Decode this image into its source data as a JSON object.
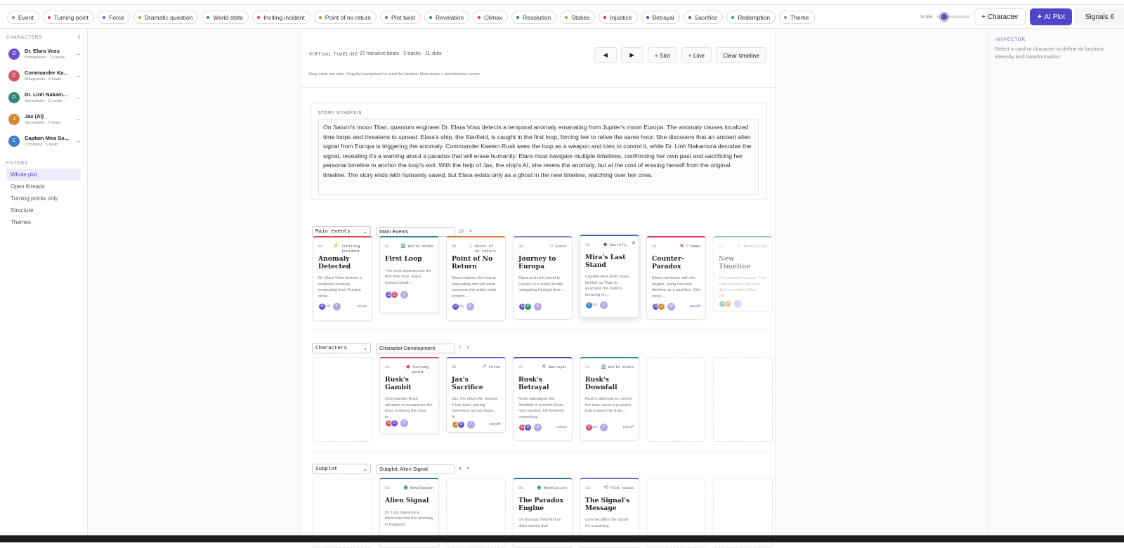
{
  "tags": [
    {
      "label": "Event",
      "color": "#8d85d6"
    },
    {
      "label": "Turning point",
      "color": "#d9475f"
    },
    {
      "label": "Force",
      "color": "#6c5ccf"
    },
    {
      "label": "Dramatic question",
      "color": "#d9863a"
    },
    {
      "label": "World state",
      "color": "#2f8a88"
    },
    {
      "label": "Inciting incident",
      "color": "#d9475f"
    },
    {
      "label": "Point of no return",
      "color": "#e07a2a"
    },
    {
      "label": "Plot twist",
      "color": "#7a5fd6"
    },
    {
      "label": "Revelation",
      "color": "#2f7da0"
    },
    {
      "label": "Climax",
      "color": "#d9385a"
    },
    {
      "label": "Resolution",
      "color": "#2f8a70"
    },
    {
      "label": "Stakes",
      "color": "#d9863a"
    },
    {
      "label": "Injustice",
      "color": "#c83a50"
    },
    {
      "label": "Betrayal",
      "color": "#4a4aa8"
    },
    {
      "label": "Sacrifice",
      "color": "#3d6aa8"
    },
    {
      "label": "Redemption",
      "color": "#2f9a8a"
    },
    {
      "label": "Theme",
      "color": "#8d85d6"
    }
  ],
  "toolbar": {
    "scale_label": "Scale",
    "character_button": "+ Character",
    "ai_button": "✦ AI Plot",
    "signals_button": "Signals 6"
  },
  "sidebar": {
    "characters_heading": "CHARACTERS",
    "characters_count": "5",
    "characters": [
      {
        "initial": "D",
        "name": "Dr. Elara Voss",
        "sub": "Protagonista · 15 beats",
        "color": "#6b4fcf"
      },
      {
        "initial": "C",
        "name": "Commander Ka...",
        "sub": "Antagonista · 4 beats",
        "color": "#d2566a"
      },
      {
        "initial": "D",
        "name": "Dr. Linh Nakam...",
        "sub": "Secondario · 11 beats",
        "color": "#2f8a7a"
      },
      {
        "initial": "J",
        "name": "Jax (AI)",
        "sub": "Secondario · 7 beats",
        "color": "#d48a30"
      },
      {
        "initial": "C",
        "name": "Captain Mira So...",
        "sub": "Comparsa · 1 beats",
        "color": "#3d7fc8"
      }
    ],
    "filters_heading": "FILTERS",
    "filters": [
      "Whole plot",
      "Open threads",
      "Turning points only",
      "Structure",
      "Themes"
    ]
  },
  "inspector": {
    "heading": "INSPECTOR",
    "text": "Select a card or character to define its function, intensity and transformation."
  },
  "timeline": {
    "heading": "VIRTUAL TIMELINE",
    "info": "27 narrative beats · 5 tracks · 11 slots",
    "buttons": {
      "prev": "◀",
      "next": "▶",
      "slot": "+ Slot",
      "line": "+ Line",
      "clear": "Clear timeline"
    },
    "hint": "Drag cards into slots. Drag the background to scroll the timeline. More tracks = simultaneous events."
  },
  "synopsis": {
    "heading": "STORY SYNOPSIS",
    "text": "On Saturn's moon Titan, quantum engineer Dr. Elara Voss detects a temporal anomaly emanating from Jupiter's moon Europa. The anomaly causes localized time loops and threatens to spread. Elara's ship, the Starfield, is caught in the first loop, forcing her to relive the same hour. She discovers that an ancient alien signal from Europa is triggering the anomaly. Commander Kaelen Rusk sees the loop as a weapon and tries to control it, while Dr. Linh Nakamura decodes the signal, revealing it's a warning about a paradox that will erase humanity. Elara must navigate multiple timelines, confronting her own past and sacrificing her personal timeline to anchor the loop's exit. With the help of Jax, the ship's AI, she resets the anomaly, but at the cost of erasing herself from the original timeline. The story ends with humanity saved, but Elara exists only as a ghost in the new timeline, watching over her crew."
  },
  "tracks": [
    {
      "type": "Main events",
      "name": "Main Events",
      "count": "10",
      "close": "×"
    },
    {
      "type": "Characters",
      "name": "Character Development",
      "count": "7",
      "close": "×"
    },
    {
      "type": "Subplot",
      "name": "Subplot: Alien Signal",
      "count": "4",
      "close": "×"
    }
  ],
  "cards": {
    "c01": {
      "num": "01",
      "type": "Inciting incident",
      "icon": "⚡",
      "title": "Anomaly Detected",
      "desc": "Dr. Elara Voss detects a temporal anomaly emanating from Europa while...",
      "badge": "7",
      "tag": "setup",
      "under": "sity"
    },
    "c02": {
      "num": "02",
      "type": "World state",
      "icon": "▥",
      "title": "First Loop",
      "desc": "The crew experiences the first time loop. Elara notices small...",
      "badge": "5",
      "tag": "",
      "under": ""
    },
    "c05": {
      "num": "05",
      "type": "Point of no return",
      "icon": "→|",
      "title": "Point of No Return",
      "desc": "Elara realizes the loop is expanding and will soon consume the entire solar system....",
      "badge": "9",
      "tag": "",
      "under": "sity"
    },
    "c08": {
      "num": "08",
      "type": "Event",
      "icon": "○",
      "title": "Journey to Europa",
      "desc": "Elara and Linh travel to Europa in a small shuttle, navigating through time-...",
      "badge": "6",
      "tag": "",
      "under": ""
    },
    "c12": {
      "num": "12",
      "type": "Sacrifi…",
      "icon": "◆",
      "title": "Mira's Last Stand",
      "desc": "Captain Mira Solis stays behind on Titan to evacuate the station, knowing sh...",
      "badge": "8",
      "tag": "",
      "under": "sity"
    },
    "c14": {
      "num": "14",
      "type": "Climax",
      "icon": "★",
      "title": "Counter-Paradox",
      "desc": "Elara interfaces with the engine, using her own timeline as a sacrifice. She creat...",
      "badge": "10",
      "tag": "payoff",
      "under": ""
    },
    "c15": {
      "num": "15",
      "type": "Resolution",
      "icon": "✓",
      "title": "New Timeline",
      "desc": "The anomaly is gone. The crew survives, but they don't remember Elara. Oh...",
      "badge": "7",
      "tag": "",
      "under": ""
    },
    "c04": {
      "num": "04",
      "type": "Turning point",
      "icon": "◆",
      "title": "Rusk's Gambit",
      "desc": "Commander Rusk attempts to weaponize the loop, ordering the crew to...",
      "badge": "8",
      "tag": "",
      "under": ""
    },
    "c06": {
      "num": "06",
      "type": "Force",
      "icon": "↗",
      "title": "Jax's Sacrifice",
      "desc": "Jax, the ship's AI, reveals it has been storing memories across loops. It...",
      "badge": "7",
      "tag": "payoff",
      "under": ""
    },
    "c07": {
      "num": "07",
      "type": "Betrayal",
      "icon": "✕",
      "title": "Rusk's Betrayal",
      "desc": "Rusk sabotages the Starfield to prevent Elara from leaving. He believes controlling...",
      "badge": "8",
      "tag": "cause",
      "under": ""
    },
    "c11": {
      "num": "11",
      "type": "World state",
      "icon": "▥",
      "title": "Rusk's Downfall",
      "desc": "Rusk's attempts to control the loop cause a paradox that erases him from...",
      "badge": "7",
      "tag": "payoff",
      "under": "sity"
    },
    "c03": {
      "num": "03",
      "type": "Revelation",
      "icon": "◉",
      "title": "Alien Signal",
      "desc": "Dr. Linh Nakamura discovers that the anomaly is triggered",
      "badge": "",
      "tag": "",
      "under": ""
    },
    "c09": {
      "num": "09",
      "type": "Revelation",
      "icon": "◉",
      "title": "The Paradox Engine",
      "desc": "On Europa, they find an alien device that",
      "badge": "",
      "tag": "",
      "under": ""
    },
    "c13": {
      "num": "13",
      "type": "Plot twist",
      "icon": "⟲",
      "title": "The Signal's Message",
      "desc": "Linh decodes the signal: it's a warning",
      "badge": "",
      "tag": "",
      "under": ""
    }
  }
}
